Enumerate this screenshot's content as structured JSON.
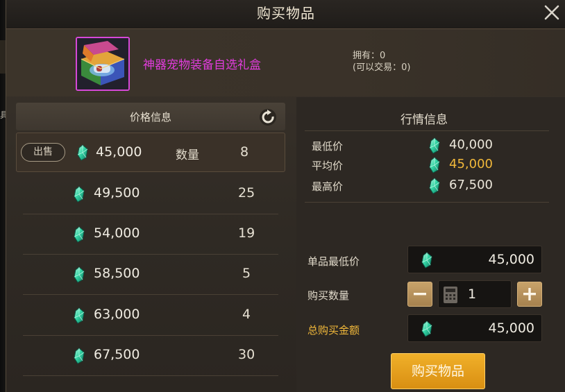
{
  "window": {
    "title": "购买物品"
  },
  "backdrop": {
    "side_glyph": "具"
  },
  "item": {
    "name": "神器宠物装备自选礼盒",
    "owned": "拥有：0",
    "tradable": "(可以交易：0)"
  },
  "price_info": {
    "header": "价格信息",
    "first_row": {
      "sell_label": "出售",
      "price": "45,000",
      "qty_label": "数量",
      "qty": "8"
    },
    "rows": [
      {
        "price": "49,500",
        "qty": "25"
      },
      {
        "price": "54,000",
        "qty": "19"
      },
      {
        "price": "58,500",
        "qty": "5"
      },
      {
        "price": "63,000",
        "qty": "4"
      },
      {
        "price": "67,500",
        "qty": "30"
      }
    ]
  },
  "market": {
    "title": "行情信息",
    "lowest_label": "最低价",
    "lowest": "40,000",
    "average_label": "平均价",
    "average": "45,000",
    "highest_label": "最高价",
    "highest": "67,500"
  },
  "purchase": {
    "unit_min_label": "单品最低价",
    "unit_min": "45,000",
    "quantity_label": "购买数量",
    "quantity": "1",
    "total_label": "总购买金额",
    "total": "45,000",
    "buy_button": "购买物品"
  },
  "colors": {
    "item_name": "#e23cdd",
    "highlight": "#f1b83a",
    "buy_button": "#e8a21f",
    "gem": "#2fd3a0"
  },
  "icons": {
    "currency": "green-gem-icon",
    "close": "close-icon",
    "refresh": "refresh-icon",
    "calculator": "calculator-icon"
  }
}
